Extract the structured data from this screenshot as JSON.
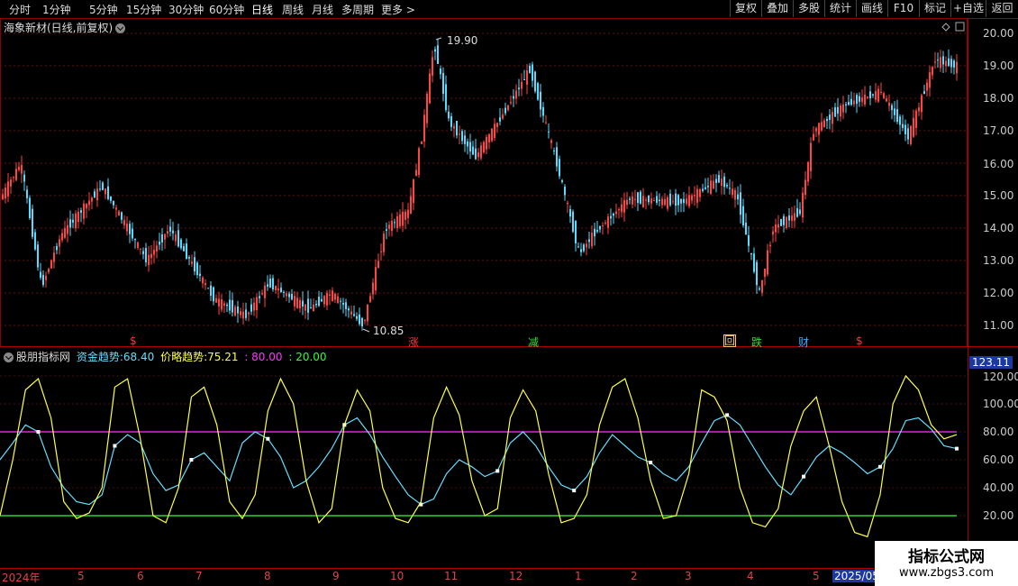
{
  "toolbar": {
    "periods": [
      "分时",
      "1分钟",
      "5分钟",
      "15分钟",
      "30分钟",
      "60分钟",
      "日线",
      "周线",
      "月线",
      "多周期",
      "更多 >"
    ],
    "active_period": "日线",
    "right_buttons": [
      "复权",
      "叠加",
      "多股",
      "统计",
      "画线",
      "F10",
      "标记",
      "+自选",
      "返回"
    ]
  },
  "stock": {
    "title": "海象新材(日线,前复权)",
    "high_label": "19.90",
    "low_label": "10.85"
  },
  "signals": [
    {
      "text": "$",
      "color": "#ff3333"
    },
    {
      "text": "涨",
      "color": "#ff3333"
    },
    {
      "text": "减",
      "color": "#33dd33"
    },
    {
      "text": "回",
      "color": "#ffcc66"
    },
    {
      "text": "跌",
      "color": "#33dd33"
    },
    {
      "text": "财",
      "color": "#33aaff"
    },
    {
      "text": "$",
      "color": "#ff3333"
    }
  ],
  "indicator": {
    "name": "股朋指标网",
    "capital_label": "资金趋势:",
    "capital_value": "68.40",
    "price_label": "价略趋势:",
    "price_value": "75.21",
    "upper_line": ": 80.00",
    "lower_line": ": 20.00",
    "current_value": "123.11"
  },
  "price_axis": [
    "20.00",
    "19.00",
    "18.00",
    "17.00",
    "16.00",
    "15.00",
    "14.00",
    "13.00",
    "12.00",
    "11.00"
  ],
  "indicator_axis": [
    "120.00",
    "100.00",
    "80.00",
    "60.00",
    "40.00",
    "20.00"
  ],
  "months": [
    "2024年",
    "5",
    "6",
    "7",
    "8",
    "9",
    "10",
    "11",
    "12",
    "1",
    "2",
    "3",
    "4",
    "5",
    "2025/05/"
  ],
  "watermark": {
    "line1": "指标公式网",
    "line2": "www.zbgs3.com"
  },
  "colors": {
    "up": "#ff4444",
    "down": "#55ddff",
    "capital": "#66ddff",
    "price": "#ffff44",
    "upper": "#ff33ff",
    "lower": "#33ff33"
  },
  "chart_data": {
    "type": "line",
    "series": [
      {
        "name": "资金趋势",
        "values": [
          60,
          72,
          85,
          80,
          55,
          40,
          30,
          28,
          35,
          70,
          78,
          72,
          50,
          38,
          42,
          60,
          65,
          55,
          45,
          72,
          80,
          75,
          62,
          40,
          45,
          55,
          68,
          85,
          90,
          78,
          62,
          48,
          35,
          28,
          32,
          50,
          60,
          55,
          48,
          52,
          72,
          80,
          70,
          55,
          42,
          38,
          48,
          65,
          78,
          70,
          62,
          58,
          50,
          45,
          55,
          72,
          88,
          92,
          85,
          70,
          55,
          42,
          35,
          48,
          62,
          70,
          65,
          58,
          50,
          55,
          68,
          88,
          90,
          82,
          70,
          68
        ]
      },
      {
        "name": "价略趋势",
        "values": [
          20,
          60,
          110,
          118,
          90,
          30,
          18,
          22,
          40,
          112,
          118,
          75,
          20,
          15,
          40,
          105,
          112,
          85,
          30,
          18,
          35,
          95,
          118,
          100,
          45,
          15,
          25,
          85,
          110,
          95,
          40,
          18,
          15,
          30,
          90,
          112,
          92,
          45,
          20,
          25,
          90,
          110,
          95,
          50,
          15,
          18,
          35,
          85,
          112,
          118,
          90,
          45,
          18,
          20,
          50,
          110,
          105,
          88,
          40,
          15,
          12,
          25,
          70,
          95,
          105,
          70,
          30,
          8,
          5,
          35,
          100,
          120,
          110,
          85,
          75,
          78
        ]
      }
    ],
    "hlines": [
      80,
      20
    ]
  }
}
